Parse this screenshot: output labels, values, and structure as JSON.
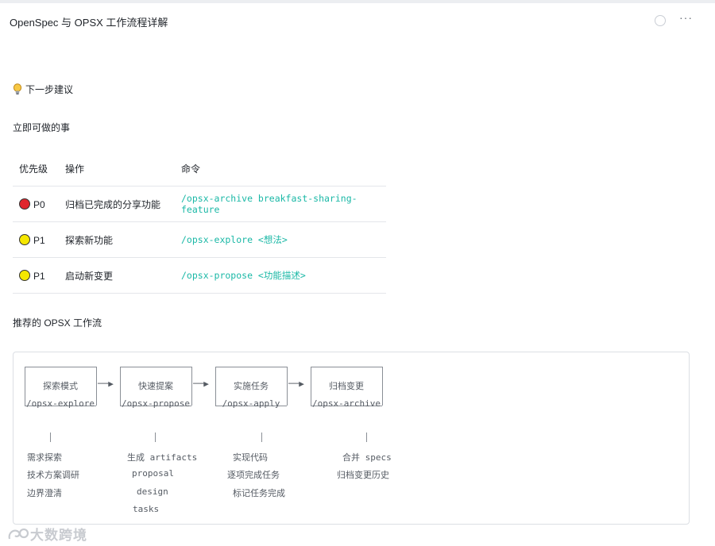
{
  "header": {
    "title": "OpenSpec 与 OPSX 工作流程详解"
  },
  "sections": {
    "next_steps": "下一步建议",
    "immediate": "立即可做的事",
    "workflow": "推荐的 OPSX 工作流"
  },
  "table": {
    "headers": [
      "优先级",
      "操作",
      "命令"
    ],
    "rows": [
      {
        "priority": "P0",
        "color": "#e0262e",
        "action": "归档已完成的分享功能",
        "command": "/opsx-archive breakfast-sharing-feature"
      },
      {
        "priority": "P1",
        "color": "#f5e700",
        "action": "探索新功能",
        "command": "/opsx-explore <想法>"
      },
      {
        "priority": "P1",
        "color": "#f5e700",
        "action": "启动新变更",
        "command": "/opsx-propose <功能描述>"
      }
    ]
  },
  "flow": {
    "stages": [
      {
        "name": "探索模式",
        "cmd": "/opsx-explore",
        "details": [
          "需求探索",
          "技术方案调研",
          "边界澄清"
        ]
      },
      {
        "name": "快速提案",
        "cmd": "/opsx-propose",
        "details": [
          "生成 artifacts",
          "proposal",
          "design",
          "tasks"
        ]
      },
      {
        "name": "实施任务",
        "cmd": "/opsx-apply",
        "details": [
          "实现代码",
          "逐项完成任务",
          "标记任务完成"
        ]
      },
      {
        "name": "归档变更",
        "cmd": "/opsx-archive",
        "details": [
          "合并 specs",
          "归档变更历史"
        ]
      }
    ],
    "arrow": "──▶"
  },
  "watermark": "大数跨境"
}
